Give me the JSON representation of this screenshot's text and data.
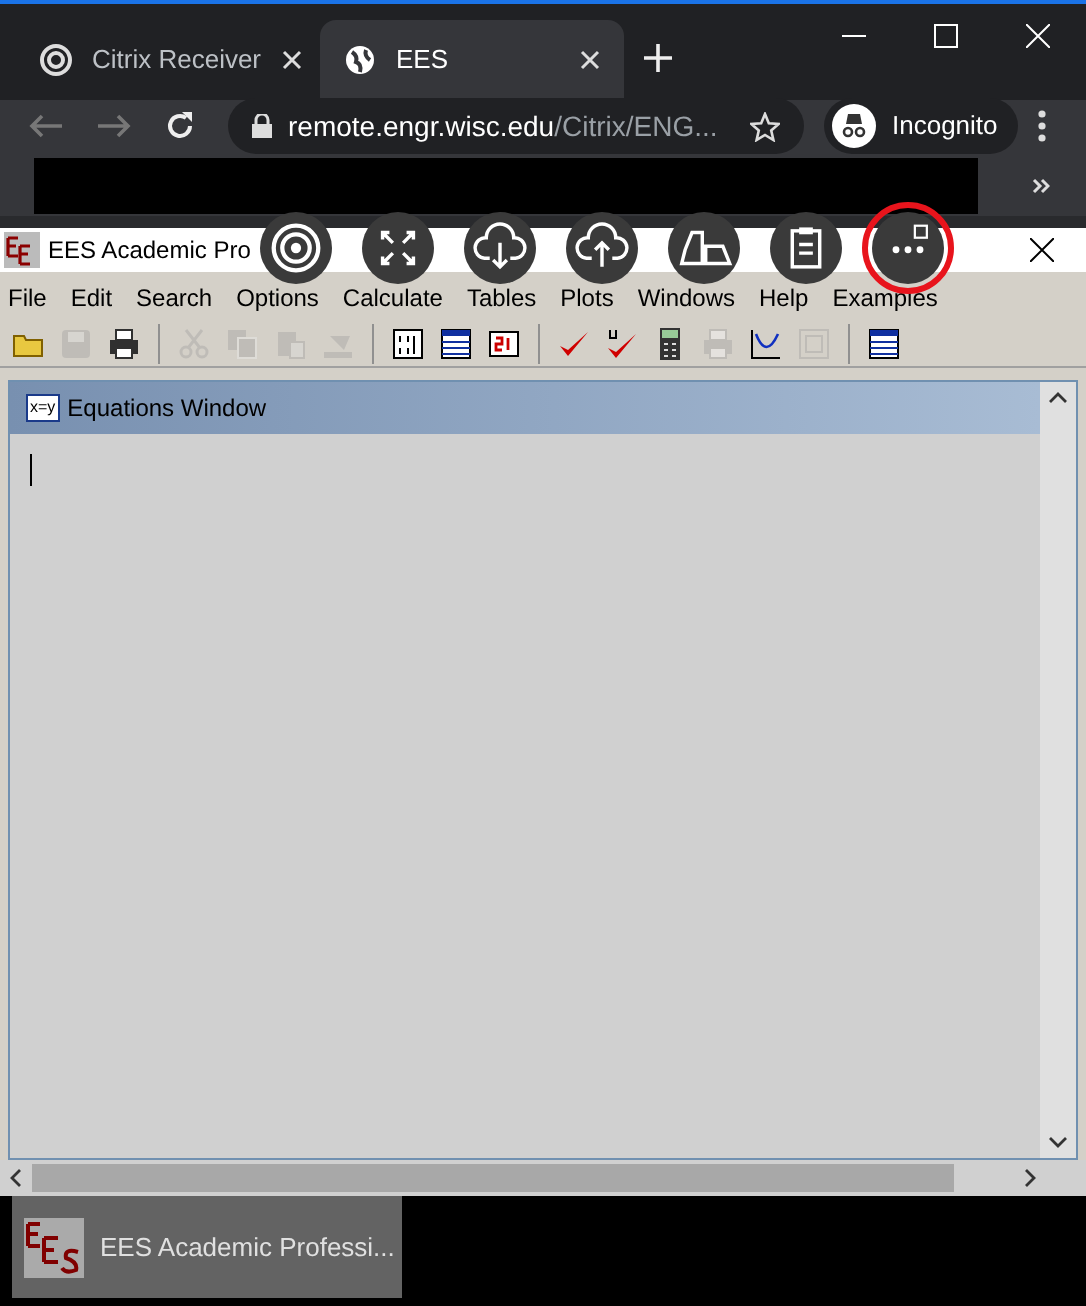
{
  "browser": {
    "tabs": [
      {
        "label": "Citrix Receiver",
        "selected": false
      },
      {
        "label": "EES",
        "selected": true
      }
    ],
    "address": {
      "host": "remote.engr.wisc.edu",
      "path": "/Citrix/ENG..."
    },
    "profile": "Incognito"
  },
  "app": {
    "title": "EES Academic Pro",
    "menu": [
      "File",
      "Edit",
      "Search",
      "Options",
      "Calculate",
      "Tables",
      "Plots",
      "Windows",
      "Help",
      "Examples"
    ],
    "toolbar": [
      {
        "kind": "open",
        "disabled": false
      },
      {
        "kind": "save",
        "disabled": true
      },
      {
        "kind": "print",
        "disabled": false
      },
      {
        "kind": "separator"
      },
      {
        "kind": "cut",
        "disabled": true
      },
      {
        "kind": "copy",
        "disabled": true
      },
      {
        "kind": "paste",
        "disabled": true
      },
      {
        "kind": "fill",
        "disabled": true
      },
      {
        "kind": "separator"
      },
      {
        "kind": "variables",
        "disabled": false
      },
      {
        "kind": "table",
        "disabled": false
      },
      {
        "kind": "units",
        "disabled": false
      },
      {
        "kind": "separator"
      },
      {
        "kind": "check",
        "disabled": false
      },
      {
        "kind": "unitcheck",
        "disabled": false
      },
      {
        "kind": "calculator",
        "disabled": false
      },
      {
        "kind": "print",
        "disabled": true
      },
      {
        "kind": "plot",
        "disabled": false
      },
      {
        "kind": "graphic",
        "disabled": true
      },
      {
        "kind": "separator"
      },
      {
        "kind": "table",
        "disabled": false
      }
    ],
    "equations_window": {
      "title": "Equations Window",
      "icon_label": "x=y"
    }
  },
  "session_toolbar": [
    {
      "kind": "logo",
      "highlighted": false
    },
    {
      "kind": "fullscreen",
      "highlighted": false
    },
    {
      "kind": "download",
      "highlighted": false
    },
    {
      "kind": "upload",
      "highlighted": false
    },
    {
      "kind": "devices",
      "highlighted": false
    },
    {
      "kind": "clipboard",
      "highlighted": false
    },
    {
      "kind": "more",
      "highlighted": true
    }
  ],
  "taskbar": {
    "items": [
      {
        "label": "EES Academic Professi..."
      }
    ]
  }
}
